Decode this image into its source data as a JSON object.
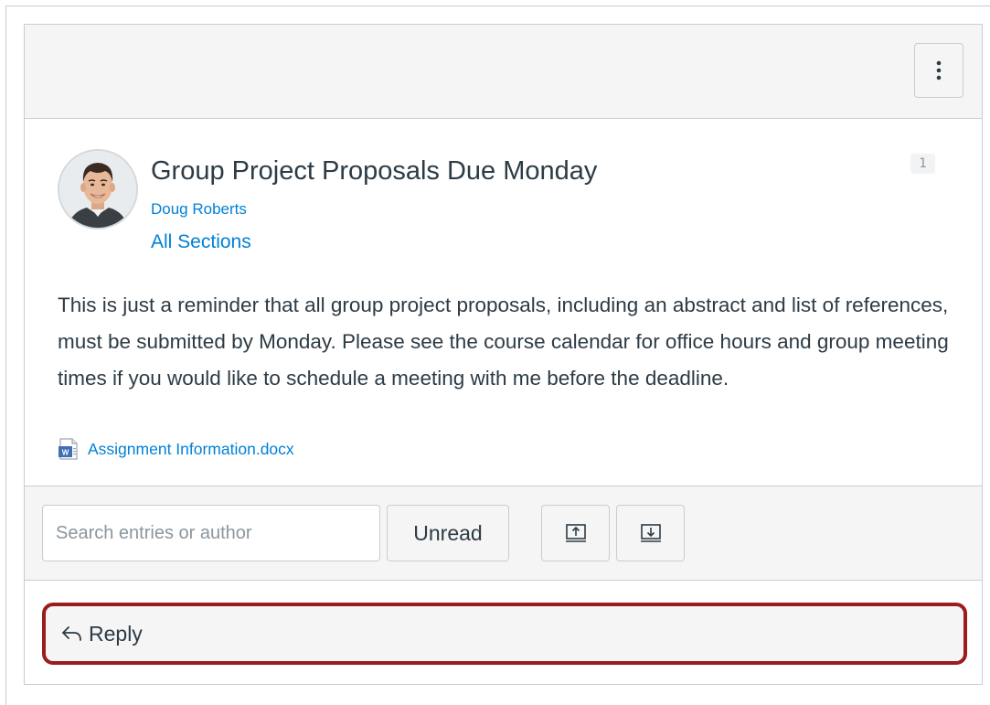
{
  "toolbar_top": {
    "menu_icon": "kebab-vertical-icon"
  },
  "announcement": {
    "title": "Group Project Proposals Due Monday",
    "author": "Doug Roberts",
    "sections": "All Sections",
    "badge_count": "1",
    "body": "This is just a reminder that all group project proposals, including an abstract and list of references, must be submitted by Monday. Please see the course calendar for office hours and group meeting times if you would like to schedule a meeting with me before the deadline.",
    "attachment": {
      "icon": "word-document-icon",
      "name": "Assignment Information.docx"
    }
  },
  "filters": {
    "search_placeholder": "Search entries or author",
    "search_value": "",
    "unread_label": "Unread",
    "up_icon": "collapse-up-icon",
    "down_icon": "expand-down-icon"
  },
  "reply": {
    "icon": "reply-arrow-icon",
    "label": "Reply",
    "highlight_color": "#9b1c1c"
  },
  "colors": {
    "link": "#0081d6",
    "text": "#2d3b45",
    "border": "#c7cdd1",
    "surface": "#f5f5f5"
  }
}
